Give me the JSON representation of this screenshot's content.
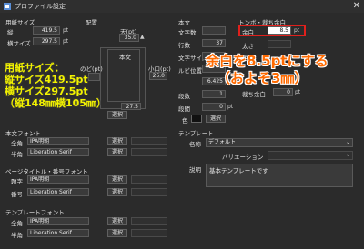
{
  "window": {
    "title": "プロファイル設定"
  },
  "paper": {
    "section": "用紙サイズ",
    "height_label": "縦",
    "height_value": "419.5",
    "width_label": "横サイズ",
    "width_value": "297.5",
    "unit": "pt"
  },
  "layout": {
    "section": "配置",
    "top_label": "天(pt)",
    "top_value": "35.0",
    "body_label": "本文",
    "nodo_label": "のど(pt)",
    "koguchi_label": "小口(pt)",
    "koguchi_value": "25.0",
    "chi_value": "27.5",
    "select_label": "選択"
  },
  "honbun": {
    "section": "本文",
    "moji_label": "文字数",
    "gyo_label": "行数",
    "gyo_value": "37",
    "moji_size_label": "文字サイズ",
    "gyo_kan_label": "ルビ位置",
    "rowspace_value": "6.425",
    "danka_label": "段数",
    "danka_value": "1",
    "dankan_label": "段間",
    "dankan_value": "0",
    "color_label": "色",
    "select_label": "選択",
    "unit": "pt"
  },
  "tombo": {
    "section": "トンボ・裁ち余白",
    "yohaku_label": "余白",
    "yohaku_value": "8.5",
    "futosa_label": "太さ",
    "iro_label": "色",
    "hairi_label": "裁ち余白",
    "hairi_value": "0",
    "unit": "pt"
  },
  "honbun_font": {
    "section": "本文フォント",
    "zen_label": "全角",
    "zen_font": "IPA明朝",
    "han_label": "半角",
    "han_font": "Liberation Serif",
    "select_label": "選択"
  },
  "page_font": {
    "section": "ページタイトル・番号フォント",
    "title_label": "題字",
    "title_font": "IPA明朝",
    "num_label": "番号",
    "num_font": "Liberation Serif",
    "select_label": "選択"
  },
  "template_font": {
    "section": "テンプレートフォント",
    "zen_label": "全角",
    "zen_font": "IPA明朝",
    "han_label": "半角",
    "han_font": "Liberation Serif",
    "select_label": "選択"
  },
  "template": {
    "section": "テンプレート",
    "name_label": "名称",
    "name_value": "デフォルト",
    "variation_label": "バリエーション",
    "desc_label": "説明",
    "desc_value": "基本テンプレートです"
  },
  "annotations": {
    "paper_line1": "用紙サイズ：",
    "paper_line2": "縦サイズ419.5pt",
    "paper_line3": "横サイズ297.5pt",
    "paper_line4": "（縦148㎜横105㎜）",
    "margin_line1": "余白を8.5ptにする",
    "margin_line2": "（およそ3㎜）"
  }
}
